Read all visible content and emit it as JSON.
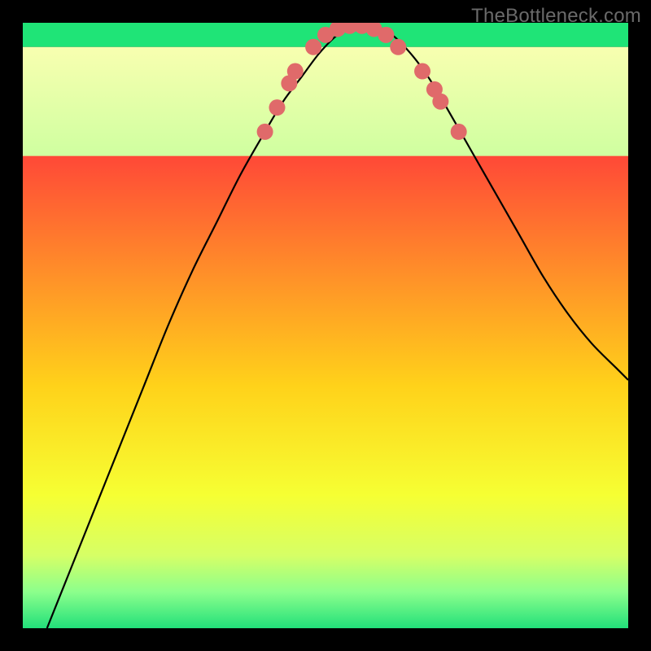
{
  "watermark": "TheBottleneck.com",
  "chart_data": {
    "type": "line",
    "title": "",
    "xlabel": "",
    "ylabel": "",
    "xlim": [
      0,
      100
    ],
    "ylim": [
      0,
      100
    ],
    "background_gradient": {
      "stops": [
        {
          "offset": 0.0,
          "color": "#ff1a4b"
        },
        {
          "offset": 0.18,
          "color": "#ff3a3a"
        },
        {
          "offset": 0.4,
          "color": "#ff8a2a"
        },
        {
          "offset": 0.6,
          "color": "#ffd21a"
        },
        {
          "offset": 0.78,
          "color": "#f6ff33"
        },
        {
          "offset": 0.88,
          "color": "#d6ff66"
        },
        {
          "offset": 0.94,
          "color": "#8cff8c"
        },
        {
          "offset": 1.0,
          "color": "#22e07a"
        }
      ]
    },
    "green_band": {
      "y_start": 96,
      "y_end": 100,
      "color": "#1fe477"
    },
    "pale_band": {
      "y_start": 78,
      "y_end": 96,
      "color_top": "#f8ffb0",
      "color_bottom": "#cfffa0"
    },
    "series": [
      {
        "name": "bottleneck-curve",
        "color": "#000000",
        "x": [
          4,
          8,
          12,
          16,
          20,
          24,
          28,
          32,
          36,
          40,
          43,
          46,
          49,
          52,
          55,
          58,
          61,
          64,
          67,
          70,
          74,
          78,
          82,
          86,
          90,
          94,
          98,
          100
        ],
        "y": [
          0,
          10,
          20,
          30,
          40,
          50,
          59,
          67,
          75,
          82,
          87,
          91,
          95,
          98,
          99.5,
          99.5,
          98,
          95,
          91,
          86,
          79,
          72,
          65,
          58,
          52,
          47,
          43,
          41
        ]
      }
    ],
    "markers": {
      "name": "highlight-dots",
      "color": "#e06a6a",
      "radius": 10,
      "points": [
        {
          "x": 40,
          "y": 82
        },
        {
          "x": 42,
          "y": 86
        },
        {
          "x": 44,
          "y": 90
        },
        {
          "x": 45,
          "y": 92
        },
        {
          "x": 48,
          "y": 96
        },
        {
          "x": 50,
          "y": 98
        },
        {
          "x": 52,
          "y": 99
        },
        {
          "x": 54,
          "y": 99.5
        },
        {
          "x": 56,
          "y": 99.5
        },
        {
          "x": 58,
          "y": 99
        },
        {
          "x": 60,
          "y": 98
        },
        {
          "x": 62,
          "y": 96
        },
        {
          "x": 66,
          "y": 92
        },
        {
          "x": 68,
          "y": 89
        },
        {
          "x": 69,
          "y": 87
        },
        {
          "x": 72,
          "y": 82
        }
      ]
    }
  }
}
